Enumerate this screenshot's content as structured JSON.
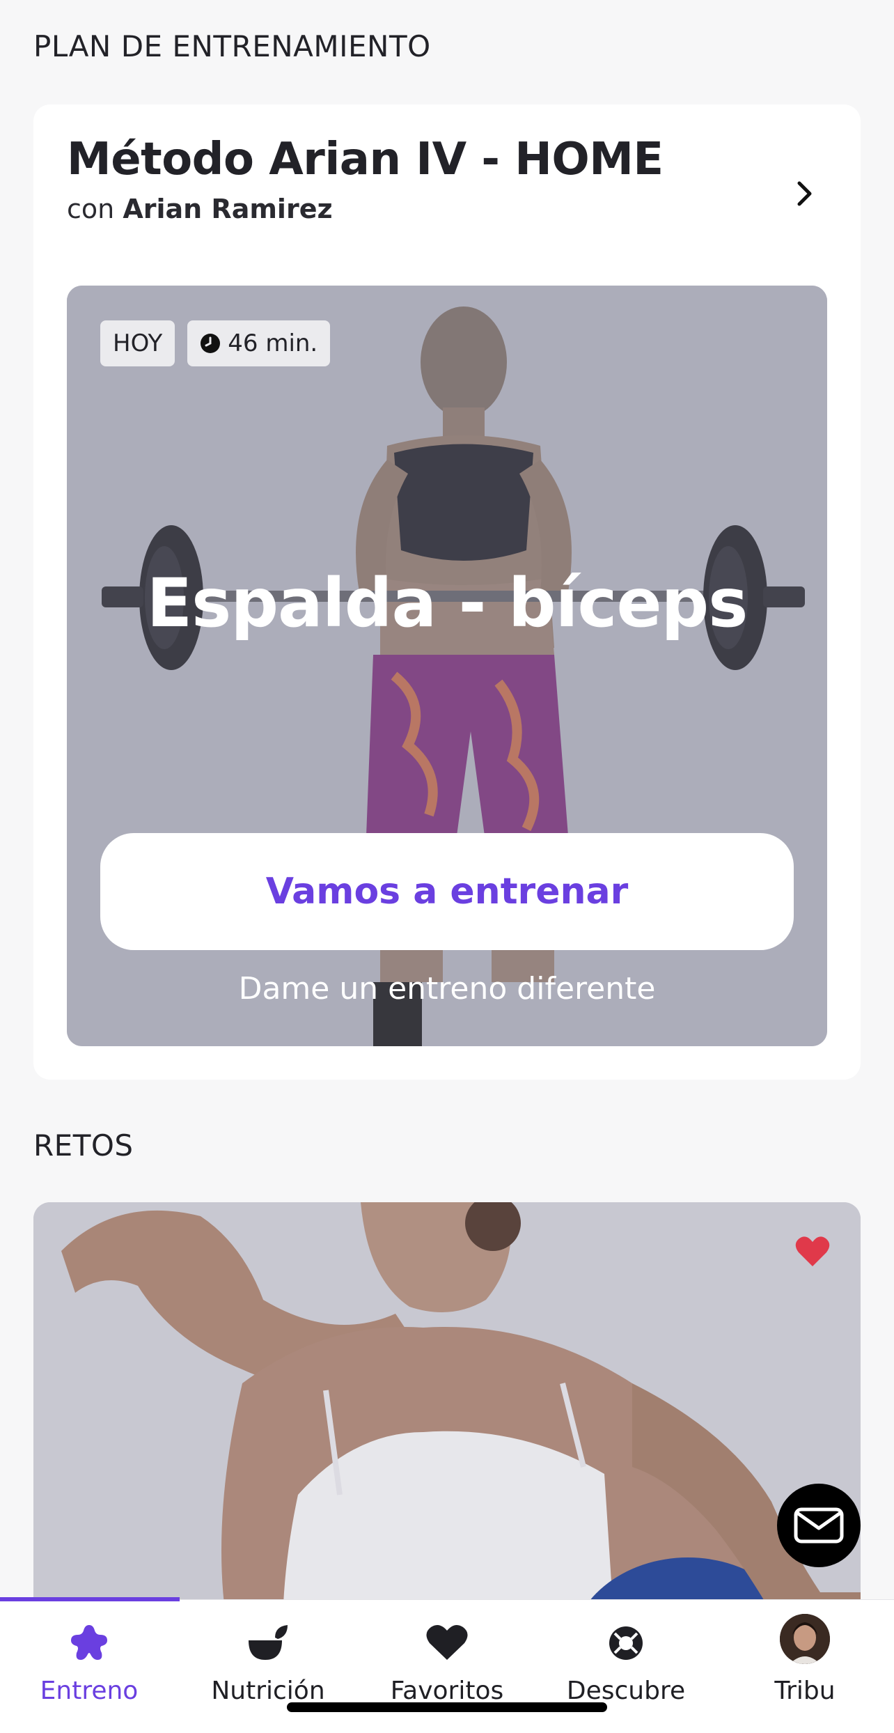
{
  "plan_section": {
    "title": "PLAN DE ENTRENAMIENTO",
    "plan_name": "Método Arian IV - HOME",
    "coach_prefix": "con",
    "coach_name": "Arian Ramirez"
  },
  "workout": {
    "badge_day": "HOY",
    "badge_duration": "46 min.",
    "title": "Espalda - bíceps",
    "primary_button": "Vamos a entrenar",
    "secondary_link": "Dame un entreno diferente"
  },
  "retos_section": {
    "title": "RETOS",
    "favorited": true
  },
  "tabs": [
    {
      "label": "Entreno",
      "icon": "star-body-icon",
      "active": true
    },
    {
      "label": "Nutrición",
      "icon": "bowl-leaf-icon",
      "active": false
    },
    {
      "label": "Favoritos",
      "icon": "heart-icon",
      "active": false
    },
    {
      "label": "Descubre",
      "icon": "compass-icon",
      "active": false
    },
    {
      "label": "Tribu",
      "icon": "avatar",
      "active": false
    }
  ],
  "colors": {
    "accent": "#6a3fe0",
    "heart": "#e0394a",
    "background": "#f7f7f8"
  }
}
